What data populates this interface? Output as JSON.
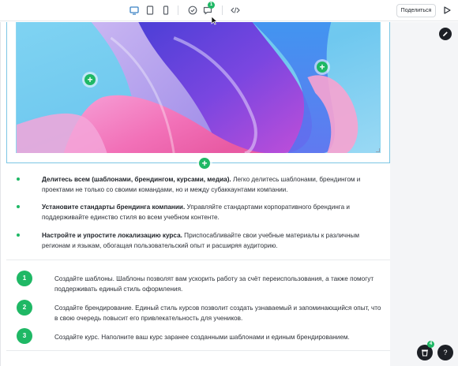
{
  "toolbar": {
    "comments_count": "1",
    "share_label": "Поделиться",
    "icons": [
      "desktop-icon",
      "tablet-icon",
      "mobile-icon",
      "check-circle-icon",
      "comment-icon",
      "code-icon",
      "play-icon"
    ]
  },
  "colors": {
    "accent": "#1fb865",
    "dark": "#1d2026",
    "selection": "#7cc6e4",
    "rail": "#f4f5f7"
  },
  "hero": {
    "description": ""
  },
  "bullets": [
    {
      "bold": "Делитесь всем (шаблонами, брендингом, курсами, медиа).",
      "text": " Легко делитесь шаблонами, брендингом и проектами не только со своими командами, но и между субаккаунтами компании."
    },
    {
      "bold": "Установите стандарты брендинга компании.",
      "text": " Управляйте стандартами корпоративного брендинга и поддерживайте единство стиля во всем учебном контенте."
    },
    {
      "bold": "Настройте и упростите локализацию курса.",
      "text": " Приспосабливайте свои учебные материалы к различным регионам и языкам, обогащая пользовательский опыт и расширяя аудиторию."
    }
  ],
  "steps": [
    {
      "number": "1",
      "text": "Создайте шаблоны. Шаблоны позволят вам ускорить работу за счёт переиспользования, а также помогут поддерживать единый стиль оформления."
    },
    {
      "number": "2",
      "text": "Создайте брендирование. Единый стиль курсов позволит создать узнаваемый и запоминающийся опыт, что в свою очередь повысит его привлекательность для учеников."
    },
    {
      "number": "3",
      "text": "Создайте курс. Наполните ваш курс заранее созданными шаблонами и единым брендированием."
    }
  ],
  "floating": {
    "trash_badge": "4",
    "help_label": "?"
  }
}
